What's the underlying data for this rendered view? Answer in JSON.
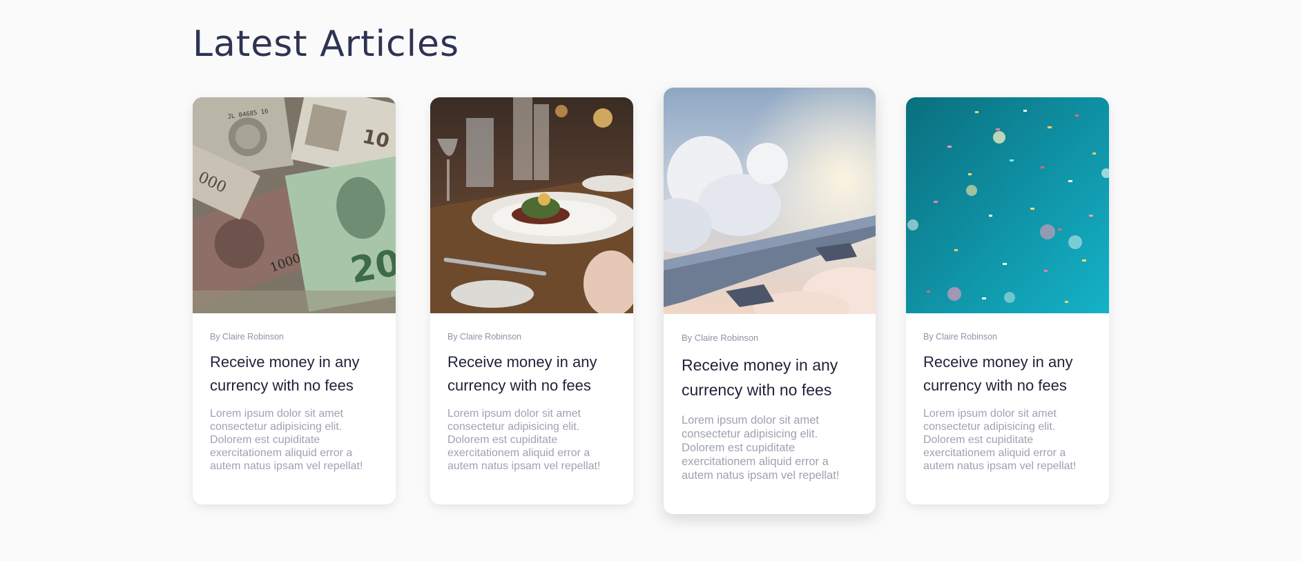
{
  "section": {
    "title": "Latest Articles"
  },
  "articles": [
    {
      "image": "money-banknotes-photo",
      "author": "By Claire Robinson",
      "title": "Receive money in any currency with no fees",
      "excerpt": "Lorem ipsum dolor sit amet consectetur adipisicing elit. Dolorem est cupiditate exercitationem aliquid error a autem natus ipsam vel repellat!"
    },
    {
      "image": "restaurant-dinner-plate-photo",
      "author": "By Claire Robinson",
      "title": "Receive money in any currency with no fees",
      "excerpt": "Lorem ipsum dolor sit amet consectetur adipisicing elit. Dolorem est cupiditate exercitationem aliquid error a autem natus ipsam vel repellat!"
    },
    {
      "image": "airplane-wing-clouds-photo",
      "author": "By Claire Robinson",
      "title": "Receive money in any currency with no fees",
      "excerpt": "Lorem ipsum dolor sit amet consectetur adipisicing elit. Dolorem est cupiditate exercitationem aliquid error a autem natus ipsam vel repellat!"
    },
    {
      "image": "confetti-teal-background-photo",
      "author": "By Claire Robinson",
      "title": "Receive money in any currency with no fees",
      "excerpt": "Lorem ipsum dolor sit amet consectetur adipisicing elit. Dolorem est cupiditate exercitationem aliquid error a autem natus ipsam vel repellat!"
    }
  ]
}
